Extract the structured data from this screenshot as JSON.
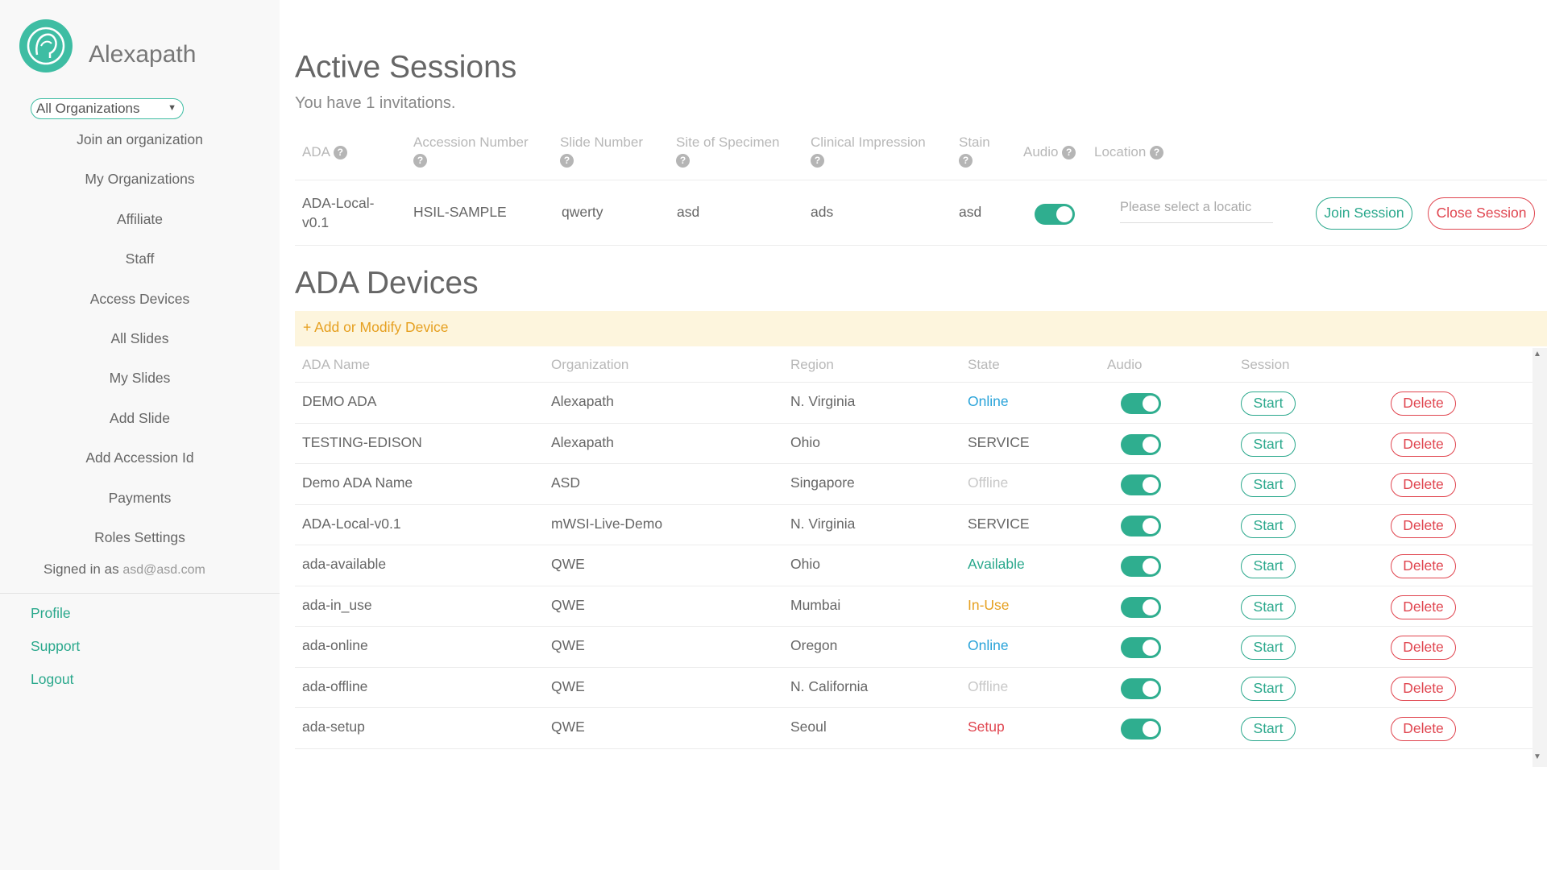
{
  "sidebar": {
    "brand": "Alexapath",
    "org_select": "All Organizations",
    "nav": [
      {
        "label": "Join an organization"
      },
      {
        "label": "My Organizations"
      },
      {
        "label": "Affiliate"
      },
      {
        "label": "Staff"
      },
      {
        "label": "Access Devices"
      },
      {
        "label": "All Slides"
      },
      {
        "label": "My Slides"
      },
      {
        "label": "Add Slide"
      },
      {
        "label": "Add Accession Id"
      },
      {
        "label": "Payments"
      },
      {
        "label": "Roles Settings"
      }
    ],
    "signed_in_prefix": "Signed in as",
    "signed_in_email": "asd@asd.com",
    "links": [
      "Profile",
      "Support",
      "Logout"
    ]
  },
  "sessions": {
    "title": "Active Sessions",
    "subtitle": "You have 1 invitations.",
    "headers": {
      "ada": "ADA",
      "accession": "Accession Number",
      "slide": "Slide Number",
      "site": "Site of Specimen",
      "clinical": "Clinical Impression",
      "stain": "Stain",
      "audio": "Audio",
      "location": "Location"
    },
    "row": {
      "ada_line1": "ADA-Local-",
      "ada_line2": "v0.1",
      "accession": "HSIL-SAMPLE",
      "slide": "qwerty",
      "site": "asd",
      "clinical": "ads",
      "stain": "asd",
      "audio_on": true,
      "location_placeholder": "Please select a locatic",
      "join_label": "Join Session",
      "close_label": "Close Session"
    }
  },
  "devices": {
    "title": "ADA Devices",
    "add_label": "+ Add or Modify Device",
    "headers": {
      "name": "ADA Name",
      "org": "Organization",
      "region": "Region",
      "state": "State",
      "audio": "Audio",
      "session": "Session"
    },
    "start_label": "Start",
    "delete_label": "Delete",
    "rows": [
      {
        "name": "DEMO ADA",
        "org": "Alexapath",
        "region": "N. Virginia",
        "state": "Online",
        "state_color": "#29a3d9"
      },
      {
        "name": "TESTING-EDISON",
        "org": "Alexapath",
        "region": "Ohio",
        "state": "SERVICE",
        "state_color": "#666666"
      },
      {
        "name": "Demo ADA Name",
        "org": "ASD",
        "region": "Singapore",
        "state": "Offline",
        "state_color": "#c8c8c8"
      },
      {
        "name": "ADA-Local-v0.1",
        "org": "mWSI-Live-Demo",
        "region": "N. Virginia",
        "state": "SERVICE",
        "state_color": "#666666"
      },
      {
        "name": "ada-available",
        "org": "QWE",
        "region": "Ohio",
        "state": "Available",
        "state_color": "#2aa88c"
      },
      {
        "name": "ada-in_use",
        "org": "QWE",
        "region": "Mumbai",
        "state": "In-Use",
        "state_color": "#e6a020"
      },
      {
        "name": "ada-online",
        "org": "QWE",
        "region": "Oregon",
        "state": "Online",
        "state_color": "#29a3d9"
      },
      {
        "name": "ada-offline",
        "org": "QWE",
        "region": "N. California",
        "state": "Offline",
        "state_color": "#c8c8c8"
      },
      {
        "name": "ada-setup",
        "org": "QWE",
        "region": "Seoul",
        "state": "Setup",
        "state_color": "#e0454f"
      }
    ]
  },
  "colors": {
    "accent": "#2aa88c",
    "danger": "#e0454f",
    "banner_bg": "#fdf5dd",
    "banner_text": "#e6a020"
  }
}
